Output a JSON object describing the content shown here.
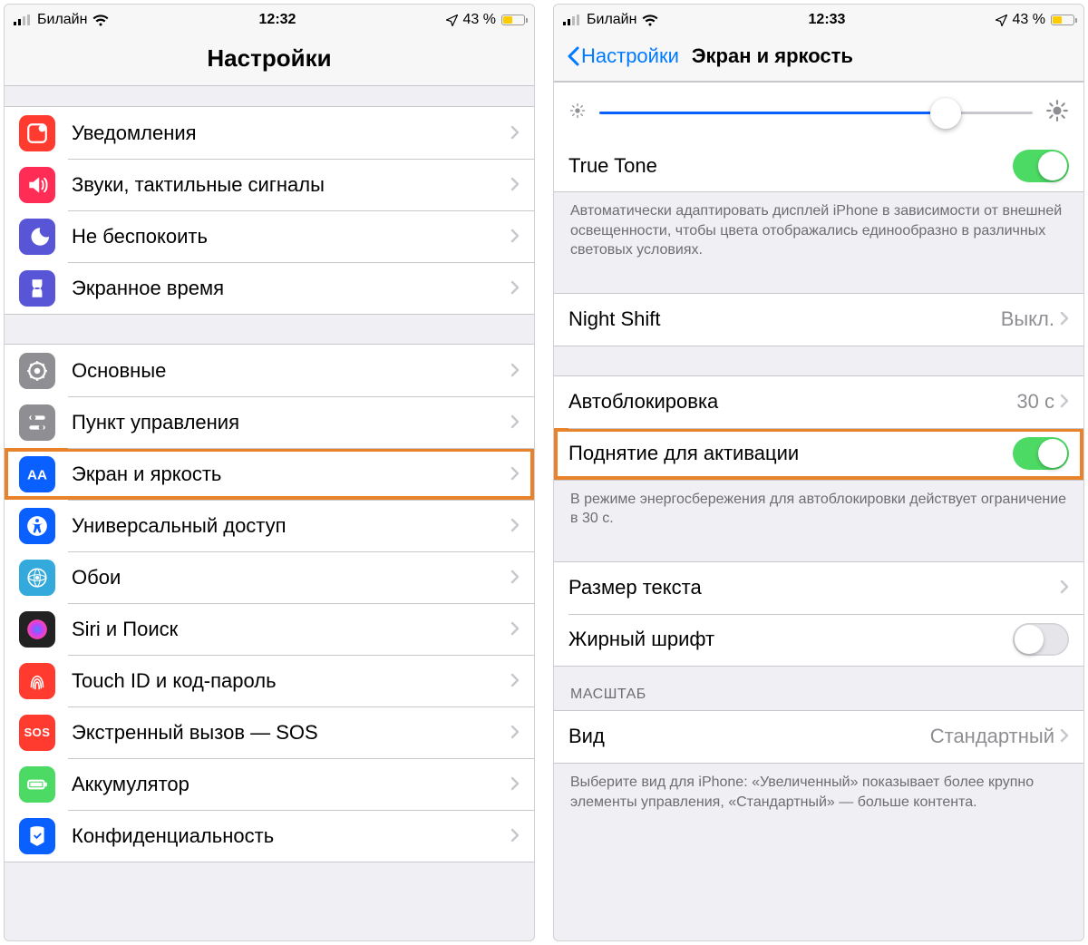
{
  "left": {
    "status": {
      "carrier": "Билайн",
      "time": "12:32",
      "battery_pct": "43 %",
      "battery_fill": 43
    },
    "title": "Настройки",
    "group1": [
      {
        "icon": "notifications",
        "color": "#ff3b30",
        "label": "Уведомления"
      },
      {
        "icon": "sounds",
        "color": "#ff2d55",
        "label": "Звуки, тактильные сигналы"
      },
      {
        "icon": "dnd",
        "color": "#5856d6",
        "label": "Не беспокоить"
      },
      {
        "icon": "screentime",
        "color": "#5856d6",
        "label": "Экранное время"
      }
    ],
    "group2": [
      {
        "icon": "general",
        "color": "#8e8e93",
        "label": "Основные"
      },
      {
        "icon": "controlcenter",
        "color": "#8e8e93",
        "label": "Пункт управления"
      },
      {
        "icon": "display",
        "color": "#0a60ff",
        "label": "Экран и яркость",
        "highlight": true
      },
      {
        "icon": "accessibility",
        "color": "#0a60ff",
        "label": "Универсальный доступ"
      },
      {
        "icon": "wallpaper",
        "color": "#34aadc",
        "label": "Обои"
      },
      {
        "icon": "siri",
        "color": "#222222",
        "label": "Siri и Поиск"
      },
      {
        "icon": "touchid",
        "color": "#ff3b30",
        "label": "Touch ID и код-пароль"
      },
      {
        "icon": "sos",
        "color": "#ff3b30",
        "label": "Экстренный вызов — SOS",
        "text_icon": "SOS"
      },
      {
        "icon": "battery",
        "color": "#4cd964",
        "label": "Аккумулятор"
      },
      {
        "icon": "privacy",
        "color": "#0a60ff",
        "label": "Конфиденциальность"
      }
    ]
  },
  "right": {
    "status": {
      "carrier": "Билайн",
      "time": "12:33",
      "battery_pct": "43 %",
      "battery_fill": 43
    },
    "back_label": "Настройки",
    "title": "Экран и яркость",
    "brightness_pct": 80,
    "rows": {
      "true_tone": "True Tone",
      "true_tone_on": true,
      "true_tone_footer": "Автоматически адаптировать дисплей iPhone в зависимости от внешней освещенности, чтобы цвета отображались единообразно в различных световых условиях.",
      "night_shift": "Night Shift",
      "night_shift_value": "Выкл.",
      "autolock": "Автоблокировка",
      "autolock_value": "30 с",
      "raise": "Поднятие для активации",
      "raise_on": true,
      "raise_highlight": true,
      "autolock_footer": "В режиме энергосбережения для автоблокировки действует ограничение в 30 с.",
      "text_size": "Размер текста",
      "bold_text": "Жирный шрифт",
      "bold_text_on": false,
      "zoom_header": "МАСШТАБ",
      "zoom_view": "Вид",
      "zoom_value": "Стандартный",
      "zoom_footer": "Выберите вид для iPhone: «Увеличенный» показывает более крупно элементы управления, «Стандартный» — больше контента."
    }
  }
}
